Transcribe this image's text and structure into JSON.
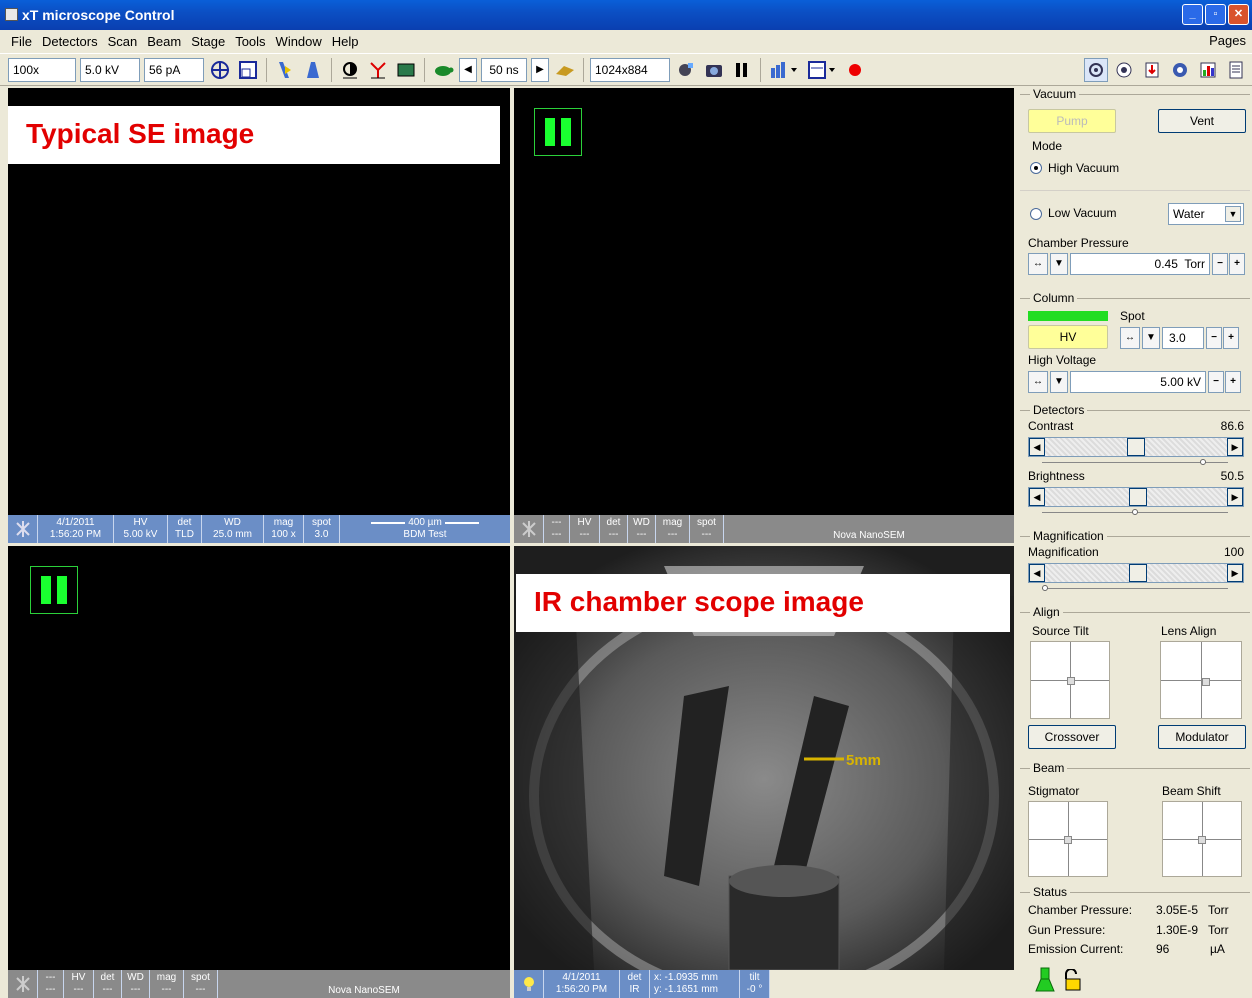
{
  "window": {
    "title": "xT microscope Control"
  },
  "menu": {
    "items": [
      "File",
      "Detectors",
      "Scan",
      "Beam",
      "Stage",
      "Tools",
      "Window",
      "Help"
    ],
    "pages": "Pages"
  },
  "toolbar": {
    "mag": "100x",
    "hv": "5.0 kV",
    "current": "56 pA",
    "dwell": "50 ns",
    "resolution": "1024x884"
  },
  "quad1": {
    "label": "Typical SE image",
    "databar": {
      "date": "4/1/2011",
      "time": "1:56:20 PM",
      "hv_label": "HV",
      "hv": "5.00 kV",
      "det_label": "det",
      "det": "TLD",
      "wd_label": "WD",
      "wd": "25.0 mm",
      "mag_label": "mag",
      "mag": "100 x",
      "spot_label": "spot",
      "spot": "3.0",
      "scalebar": "400 µm",
      "name": "BDM Test"
    }
  },
  "quad2": {
    "databar": {
      "c1": "---",
      "hv": "HV",
      "det": "det",
      "wd": "WD",
      "mag": "mag",
      "spot": "spot",
      "dash": "---",
      "name": "Nova NanoSEM"
    }
  },
  "quad3": {
    "databar": {
      "c1": "---",
      "hv": "HV",
      "det": "det",
      "wd": "WD",
      "mag": "mag",
      "spot": "spot",
      "dash": "---",
      "name": "Nova NanoSEM"
    }
  },
  "quad4": {
    "label": "IR chamber scope image",
    "scale": "5mm",
    "databar": {
      "date": "4/1/2011",
      "time": "1:56:20 PM",
      "det_label": "det",
      "det": "IR",
      "x": "x: -1.0935 mm",
      "y": "y: -1.1651 mm",
      "tilt_label": "tilt",
      "tilt": "-0 °"
    }
  },
  "vacuum": {
    "title": "Vacuum",
    "pump": "Pump",
    "vent": "Vent",
    "mode_title": "Mode",
    "high_vacuum": "High Vacuum",
    "low_vacuum": "Low Vacuum",
    "gas": "Water",
    "chamber_pressure_label": "Chamber Pressure",
    "chamber_pressure": "0.45",
    "unit": "Torr"
  },
  "column": {
    "title": "Column",
    "spot_label": "Spot",
    "hv_button": "HV",
    "spot": "3.0",
    "high_voltage_label": "High Voltage",
    "high_voltage": "5.00 kV"
  },
  "detectors": {
    "title": "Detectors",
    "contrast_label": "Contrast",
    "contrast": "86.6",
    "brightness_label": "Brightness",
    "brightness": "50.5"
  },
  "magnification": {
    "title": "Magnification",
    "label": "Magnification",
    "value": "100"
  },
  "align": {
    "title": "Align",
    "source_tilt": "Source Tilt",
    "lens_align": "Lens Align",
    "crossover": "Crossover",
    "modulator": "Modulator"
  },
  "beam": {
    "title": "Beam",
    "stigmator": "Stigmator",
    "beam_shift": "Beam Shift"
  },
  "status": {
    "title": "Status",
    "chamber_pressure_label": "Chamber Pressure:",
    "chamber_pressure": "3.05E-5",
    "chamber_unit": "Torr",
    "gun_pressure_label": "Gun Pressure:",
    "gun_pressure": "1.30E-9",
    "gun_unit": "Torr",
    "emission_label": "Emission Current:",
    "emission": "96",
    "emission_unit": "µA"
  }
}
